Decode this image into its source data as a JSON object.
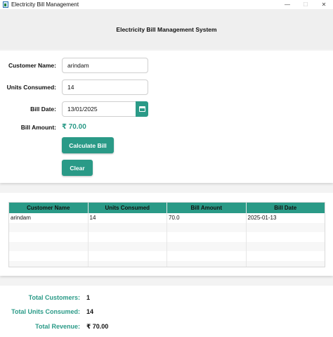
{
  "window": {
    "title": "Electricity Bill Management",
    "controls": {
      "minimize": "—",
      "maximize": "☐",
      "close": "✕"
    }
  },
  "header": {
    "title": "Electricity Bill Management System"
  },
  "form": {
    "customer_name_label": "Customer Name:",
    "customer_name_value": "arindam",
    "units_label": "Units Consumed:",
    "units_value": "14",
    "date_label": "Bill Date:",
    "date_value": "13/01/2025",
    "amount_label": "Bill Amount:",
    "amount_value": "₹ 70.00",
    "calculate_label": "Calculate Bill",
    "clear_label": "Clear"
  },
  "table": {
    "columns": [
      "Customer Name",
      "Units Consumed",
      "Bill Amount",
      "Bill Date"
    ],
    "rows": [
      [
        "arindam",
        "14",
        "70.0",
        "2025-01-13"
      ],
      [
        "",
        "",
        "",
        ""
      ],
      [
        "",
        "",
        "",
        ""
      ],
      [
        "",
        "",
        "",
        ""
      ],
      [
        "",
        "",
        "",
        ""
      ],
      [
        "",
        "",
        "",
        ""
      ]
    ]
  },
  "totals": {
    "customers_label": "Total Customers:",
    "customers_value": "1",
    "units_label": "Total Units Consumed:",
    "units_value": "14",
    "revenue_label": "Total Revenue:",
    "revenue_value": "₹ 70.00"
  },
  "colors": {
    "accent": "#2a9a87"
  }
}
